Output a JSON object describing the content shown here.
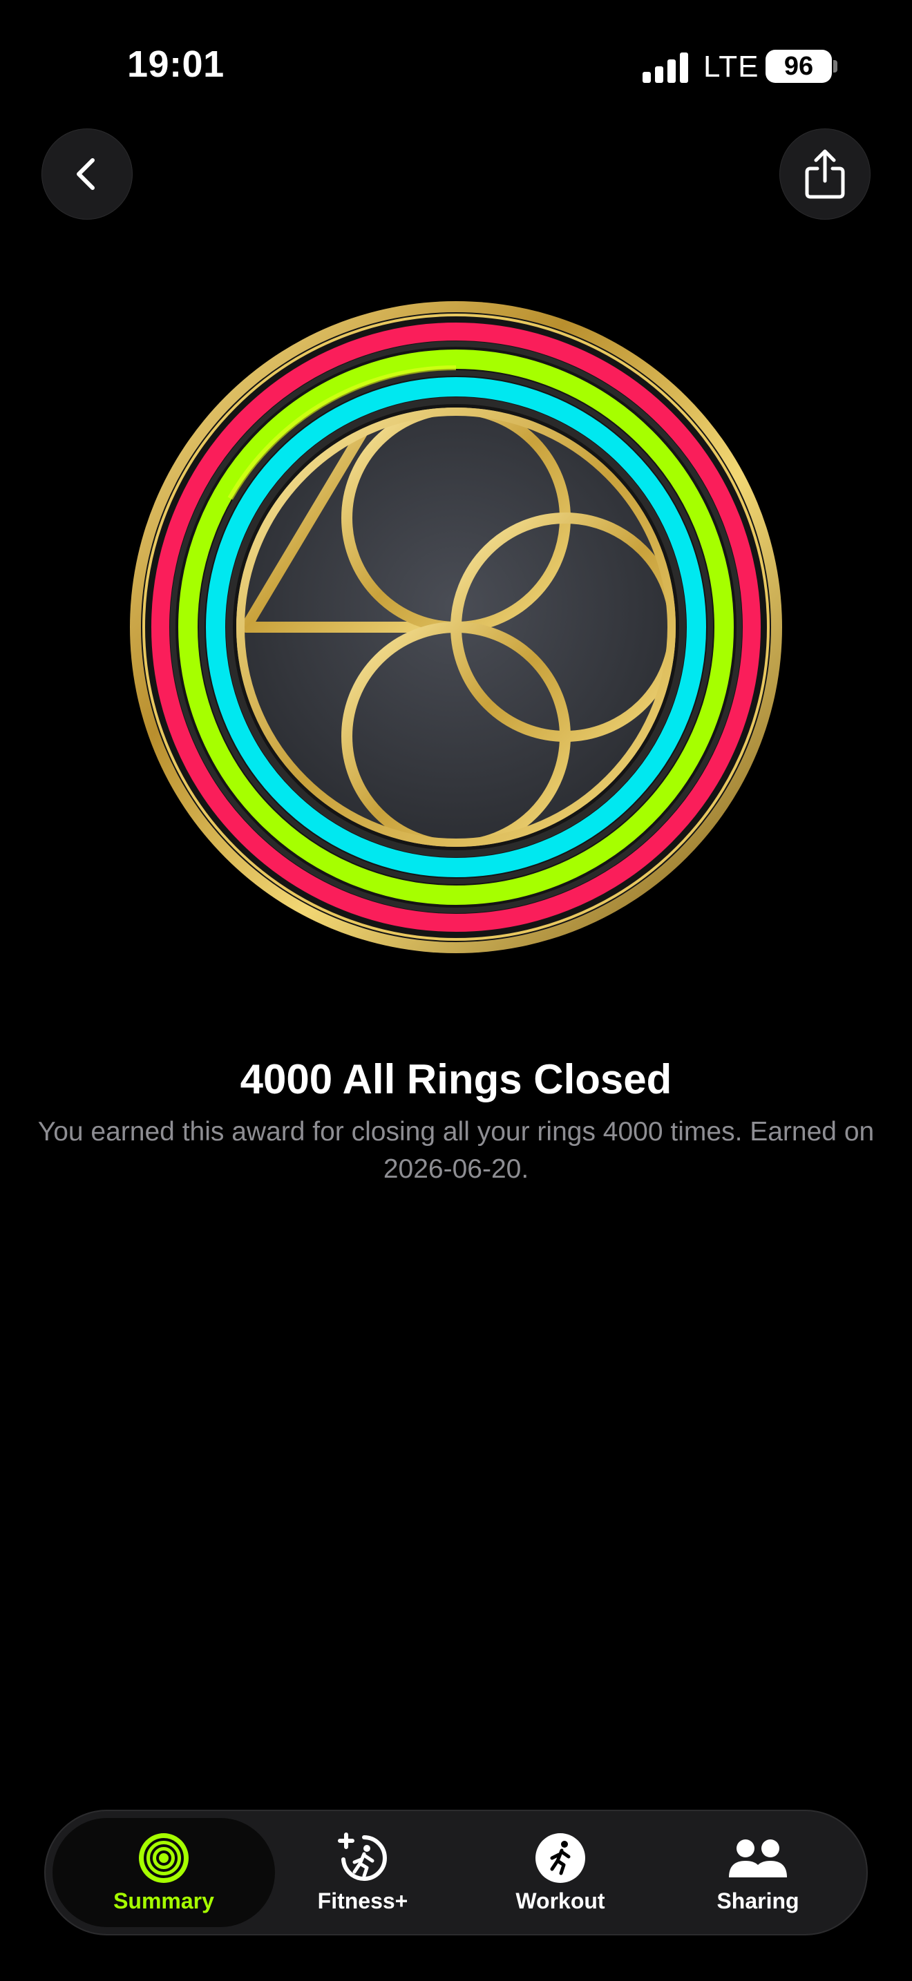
{
  "status_bar": {
    "time": "19:01",
    "network": "LTE",
    "battery": "96"
  },
  "award": {
    "title": "4000 All Rings Closed",
    "description": "You earned this award for closing all your rings 4000 times. Earned on 2026-06-20."
  },
  "tabs": [
    {
      "label": "Summary",
      "icon": "activity-rings-icon",
      "selected": true
    },
    {
      "label": "Fitness+",
      "icon": "fitness-plus-icon",
      "selected": false
    },
    {
      "label": "Workout",
      "icon": "running-figure-icon",
      "selected": false
    },
    {
      "label": "Sharing",
      "icon": "people-icon",
      "selected": false
    }
  ],
  "colors": {
    "move_ring": "#fa1e5a",
    "exercise_ring": "#a6ff00",
    "stand_ring": "#00f0ff",
    "gold": "#d4b44a",
    "accent": "#a6ff00"
  }
}
